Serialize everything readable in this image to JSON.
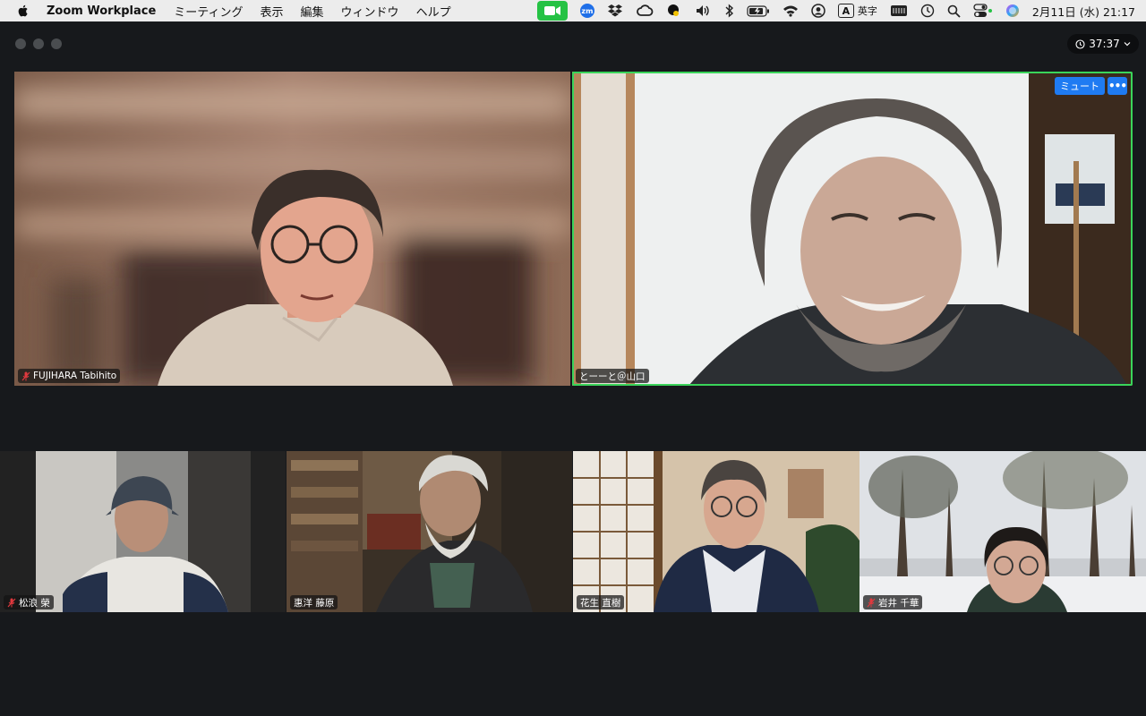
{
  "menubar": {
    "app_name": "Zoom Workplace",
    "menus": [
      "ミーティング",
      "表示",
      "編集",
      "ウィンドウ",
      "ヘルプ"
    ],
    "status": {
      "zoom_badge": "zm",
      "input_source_letter": "A",
      "input_source_label": "英字",
      "datetime": "2月11日 (水)  21:17"
    }
  },
  "meeting": {
    "timer": "37:37",
    "mute_button_label": "ミュート",
    "more_button_label": "•••"
  },
  "participants": [
    {
      "name": "FUJIHARA Tabihito",
      "muted": true
    },
    {
      "name": "とーーと＠山口",
      "muted": false,
      "active_speaker": true
    },
    {
      "name": "松浪 榮",
      "muted": true
    },
    {
      "name": "惠洋 藤原",
      "muted": false
    },
    {
      "name": "花生 直樹",
      "muted": false
    },
    {
      "name": "岩井 千華",
      "muted": true
    }
  ],
  "colors": {
    "active_speaker_border": "#3ad45a",
    "button_blue": "#1f7bf2",
    "muted_mic": "#e0393e",
    "zoom_camera_green": "#25c244"
  }
}
